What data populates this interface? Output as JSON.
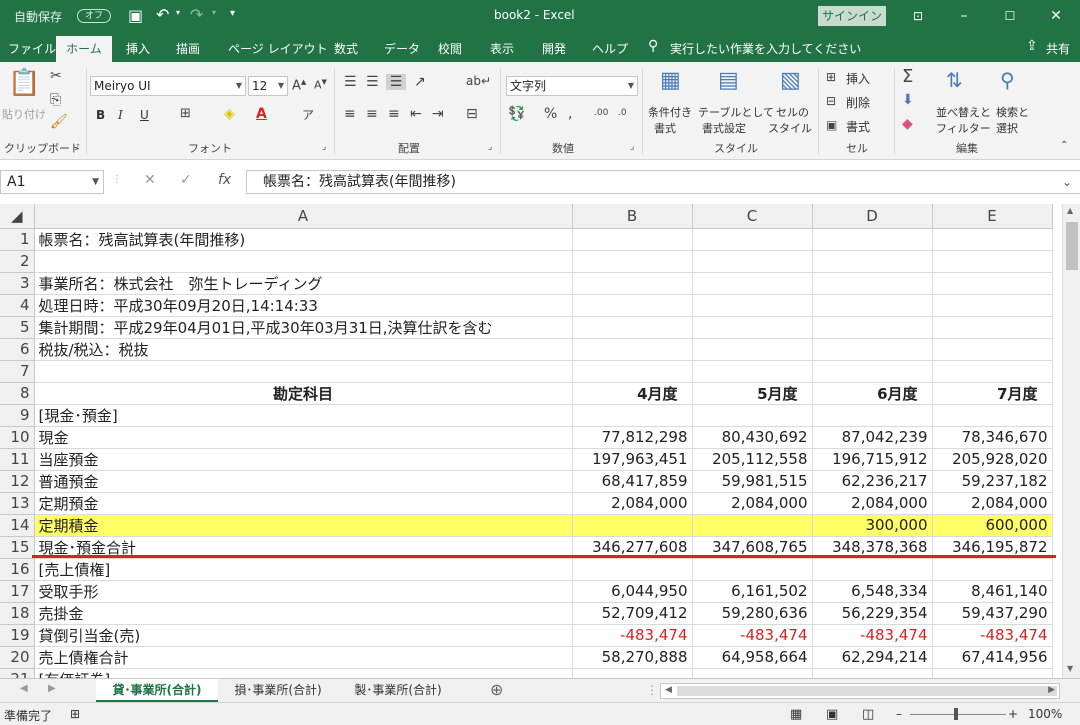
{
  "titlebar": {
    "autosave_label": "自動保存",
    "autosave_state": "オフ",
    "title": "book2 - Excel",
    "signin": "サインイン"
  },
  "menu": {
    "tabs": [
      "ファイル",
      "ホーム",
      "挿入",
      "描画",
      "ページ レイアウト",
      "数式",
      "データ",
      "校閲",
      "表示",
      "開発",
      "ヘルプ"
    ],
    "search_placeholder": "実行したい作業を入力してください",
    "share": "共有"
  },
  "ribbon": {
    "clipboard": {
      "paste": "貼り付け",
      "group": "クリップボード"
    },
    "font": {
      "name": "Meiryo UI",
      "size": "12",
      "group": "フォント",
      "bold": "B",
      "italic": "I",
      "underline": "U"
    },
    "alignment": {
      "group": "配置"
    },
    "number": {
      "format": "文字列",
      "group": "数値"
    },
    "styles": {
      "conditional": "条件付き\n書式",
      "conditional_1": "条件付き",
      "conditional_2": "書式",
      "table_1": "テーブルとして",
      "table_2": "書式設定",
      "cell_1": "セルの",
      "cell_2": "スタイル",
      "group": "スタイル"
    },
    "cells": {
      "insert": "挿入",
      "delete": "削除",
      "format": "書式",
      "group": "セル"
    },
    "editing": {
      "sort_1": "並べ替えと",
      "sort_2": "フィルター",
      "find_1": "検索と",
      "find_2": "選択",
      "group": "編集"
    }
  },
  "formula_bar": {
    "name_box": "A1",
    "formula": "帳票名：残高試算表(年間推移)"
  },
  "columns": [
    "A",
    "B",
    "C",
    "D",
    "E"
  ],
  "rows": [
    {
      "n": "1",
      "a": "帳票名：残高試算表(年間推移)",
      "b": "",
      "c": "",
      "d": "",
      "e": ""
    },
    {
      "n": "2",
      "a": "",
      "b": "",
      "c": "",
      "d": "",
      "e": ""
    },
    {
      "n": "3",
      "a": "事業所名：株式会社　弥生トレーディング",
      "b": "",
      "c": "",
      "d": "",
      "e": ""
    },
    {
      "n": "4",
      "a": "処理日時：平成30年09月20日,14:14:33",
      "b": "",
      "c": "",
      "d": "",
      "e": ""
    },
    {
      "n": "5",
      "a": "集計期間：平成29年04月01日,平成30年03月31日,決算仕訳を含む",
      "b": "",
      "c": "",
      "d": "",
      "e": ""
    },
    {
      "n": "6",
      "a": "税抜/税込：税抜",
      "b": "",
      "c": "",
      "d": "",
      "e": ""
    },
    {
      "n": "7",
      "a": "",
      "b": "",
      "c": "",
      "d": "",
      "e": ""
    },
    {
      "n": "8",
      "a": "勘定科目",
      "b": "4月度",
      "c": "5月度",
      "d": "6月度",
      "e": "7月度"
    },
    {
      "n": "9",
      "a": "[現金･預金]",
      "b": "",
      "c": "",
      "d": "",
      "e": ""
    },
    {
      "n": "10",
      "a": "現金",
      "b": "77,812,298",
      "c": "80,430,692",
      "d": "87,042,239",
      "e": "78,346,670"
    },
    {
      "n": "11",
      "a": "当座預金",
      "b": "197,963,451",
      "c": "205,112,558",
      "d": "196,715,912",
      "e": "205,928,020"
    },
    {
      "n": "12",
      "a": "普通預金",
      "b": "68,417,859",
      "c": "59,981,515",
      "d": "62,236,217",
      "e": "59,237,182"
    },
    {
      "n": "13",
      "a": "定期預金",
      "b": "2,084,000",
      "c": "2,084,000",
      "d": "2,084,000",
      "e": "2,084,000"
    },
    {
      "n": "14",
      "a": "定期積金",
      "b": "",
      "c": "",
      "d": "300,000",
      "e": "600,000"
    },
    {
      "n": "15",
      "a": "現金･預金合計",
      "b": "346,277,608",
      "c": "347,608,765",
      "d": "348,378,368",
      "e": "346,195,872"
    },
    {
      "n": "16",
      "a": "[売上債権]",
      "b": "",
      "c": "",
      "d": "",
      "e": ""
    },
    {
      "n": "17",
      "a": "受取手形",
      "b": "6,044,950",
      "c": "6,161,502",
      "d": "6,548,334",
      "e": "8,461,140"
    },
    {
      "n": "18",
      "a": "売掛金",
      "b": "52,709,412",
      "c": "59,280,636",
      "d": "56,229,354",
      "e": "59,437,290"
    },
    {
      "n": "19",
      "a": "貸倒引当金(売)",
      "b": "-483,474",
      "c": "-483,474",
      "d": "-483,474",
      "e": "-483,474"
    },
    {
      "n": "20",
      "a": "売上債権合計",
      "b": "58,270,888",
      "c": "64,958,664",
      "d": "62,294,214",
      "e": "67,414,956"
    },
    {
      "n": "21",
      "a": "[有価証券]",
      "b": "",
      "c": "",
      "d": "",
      "e": ""
    }
  ],
  "sheet_tabs": [
    "貸･事業所(合計)",
    "損･事業所(合計)",
    "製･事業所(合計)"
  ],
  "status": {
    "ready": "準備完了",
    "zoom": "100%"
  },
  "colors": {
    "accent": "#217346",
    "highlight": "#ffff66",
    "negative": "#e02020"
  }
}
